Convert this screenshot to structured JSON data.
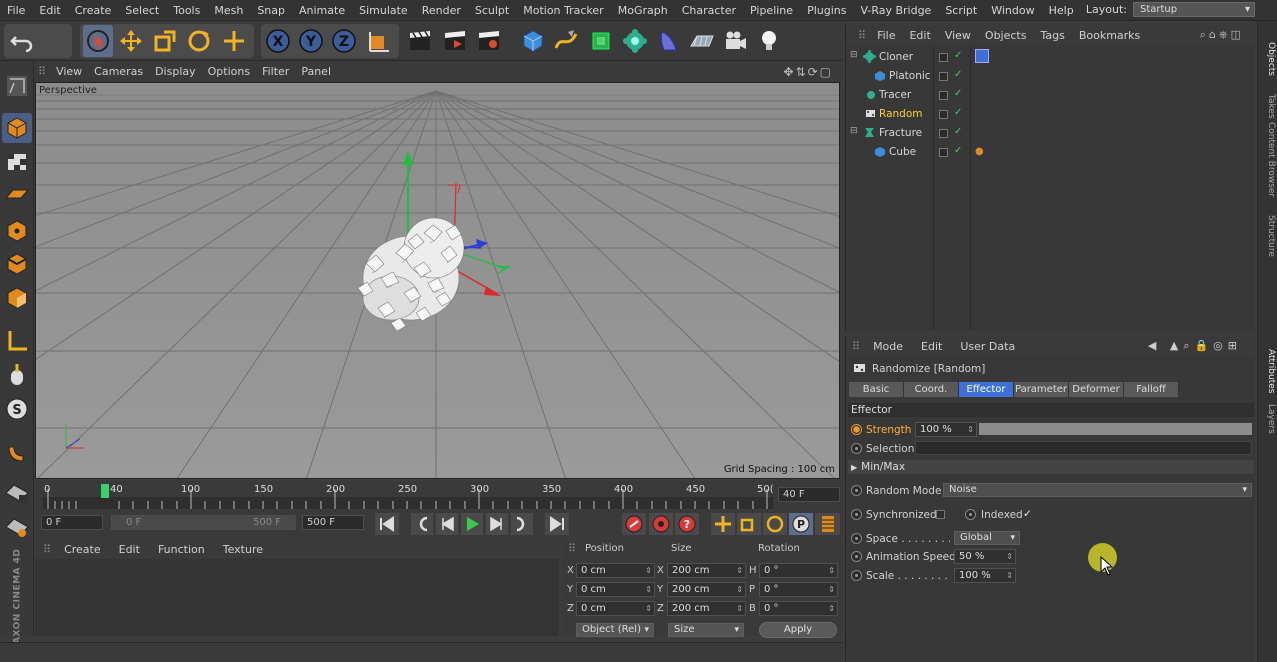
{
  "menubar": {
    "items": [
      "File",
      "Edit",
      "Create",
      "Select",
      "Tools",
      "Mesh",
      "Snap",
      "Animate",
      "Simulate",
      "Render",
      "Sculpt",
      "Motion Tracker",
      "MoGraph",
      "Character",
      "Pipeline",
      "Plugins",
      "V-Ray Bridge",
      "Script",
      "Window",
      "Help"
    ],
    "layout_label": "Layout:",
    "layout_value": "Startup"
  },
  "viewport": {
    "menu": [
      "View",
      "Cameras",
      "Display",
      "Options",
      "Filter",
      "Panel"
    ],
    "label": "Perspective",
    "grid_spacing": "Grid Spacing : 100 cm"
  },
  "timeline": {
    "ticks": [
      "0",
      "40",
      "100",
      "150",
      "200",
      "250",
      "300",
      "350",
      "400",
      "450",
      "50("
    ],
    "current_frame": "40 F"
  },
  "playback": {
    "start": "0 F",
    "range_start": "0 F",
    "range_end": "500 F",
    "end": "500 F"
  },
  "materials": {
    "menu": [
      "Create",
      "Edit",
      "Function",
      "Texture"
    ]
  },
  "coordinates": {
    "headers": {
      "position": "Position",
      "size": "Size",
      "rotation": "Rotation"
    },
    "rows": [
      {
        "axis": "X",
        "pos": "0 cm",
        "size_axis": "X",
        "size": "200 cm",
        "rot_axis": "H",
        "rot": "0 °"
      },
      {
        "axis": "Y",
        "pos": "0 cm",
        "size_axis": "Y",
        "size": "200 cm",
        "rot_axis": "P",
        "rot": "0 °"
      },
      {
        "axis": "Z",
        "pos": "0 cm",
        "size_axis": "Z",
        "size": "200 cm",
        "rot_axis": "B",
        "rot": "0 °"
      }
    ],
    "mode": "Object (Rel)",
    "size_mode": "Size",
    "apply": "Apply"
  },
  "objects": {
    "menu": [
      "File",
      "Edit",
      "View",
      "Objects",
      "Tags",
      "Bookmarks"
    ],
    "items": [
      {
        "name": "Cloner"
      },
      {
        "name": "Platonic"
      },
      {
        "name": "Tracer"
      },
      {
        "name": "Random"
      },
      {
        "name": "Fracture"
      },
      {
        "name": "Cube"
      }
    ]
  },
  "attributes": {
    "menu": [
      "Mode",
      "Edit",
      "User Data"
    ],
    "title": "Randomize [Random]",
    "tabs": [
      "Basic",
      "Coord.",
      "Effector",
      "Parameter",
      "Deformer",
      "Falloff"
    ],
    "section": "Effector",
    "strength_label": "Strength",
    "strength_value": "100 %",
    "strength_fraction": 1.0,
    "selection_label": "Selection",
    "minmax_label": "Min/Max",
    "random_mode_label": "Random Mode",
    "random_mode_value": "Noise",
    "synchronized_label": "Synchronized",
    "indexed_label": "Indexed",
    "indexed_check": "✓",
    "space_label": "Space . . . . . . . . .",
    "space_value": "Global",
    "anim_speed_label": "Animation Speed",
    "anim_speed_value": "50 %",
    "scale_label": "Scale . . . . . . . . .",
    "scale_value": "100 %"
  },
  "rightdock": {
    "tabs_top": [
      "Objects",
      "Takes",
      "Content Browser",
      "Structure"
    ],
    "tabs_bottom": [
      "Attributes",
      "Layers"
    ]
  },
  "brand": "MAXON CINEMA 4D",
  "colors": {
    "accent": "#3f6fd8",
    "highlight": "#ffcf3a",
    "strength": "#e79a25"
  }
}
